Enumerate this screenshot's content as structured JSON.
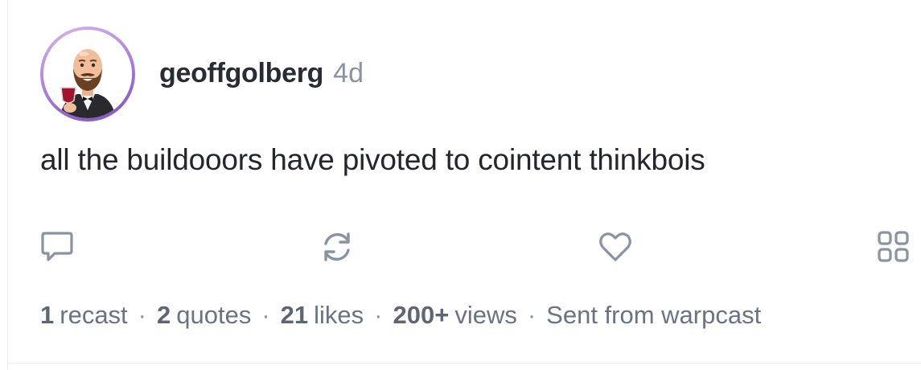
{
  "post": {
    "author": "geoffgolberg",
    "time_ago": "4d",
    "text": "all the buildooors have pivoted to cointent thinkbois"
  },
  "actions": {
    "reply_icon": "speech-bubble-icon",
    "recast_icon": "recast-arrows-icon",
    "like_icon": "heart-icon",
    "more_icon": "grid-icon"
  },
  "stats": {
    "recast_count": "1",
    "recast_label": "recast",
    "quotes_count": "2",
    "quotes_label": "quotes",
    "likes_count": "21",
    "likes_label": "likes",
    "views_count": "200+",
    "views_label": "views",
    "separator": "·",
    "client": "Sent from warpcast"
  },
  "colors": {
    "text_primary": "#24262b",
    "text_muted": "#8b93a1",
    "icon_gray": "#8b93a1",
    "avatar_ring": "#a97ad6"
  }
}
